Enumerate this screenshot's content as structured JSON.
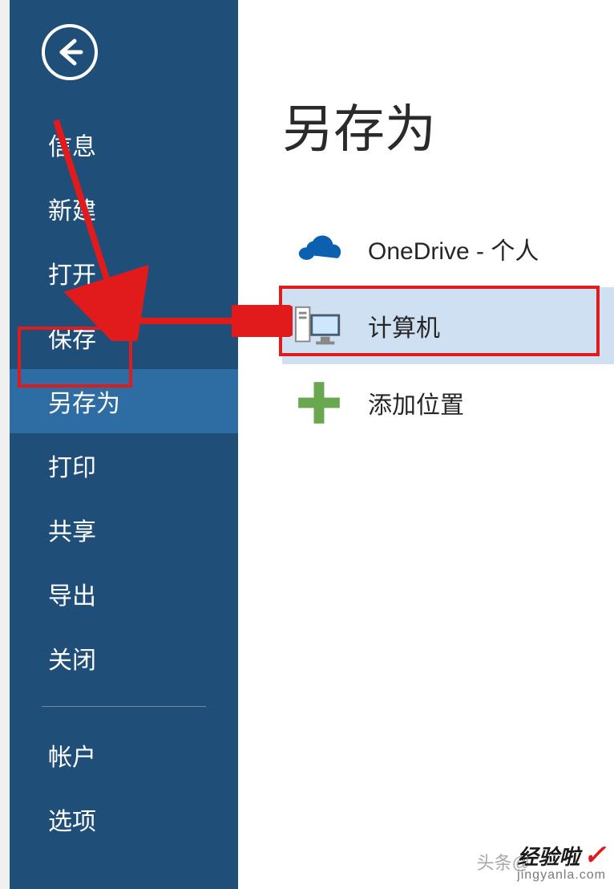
{
  "sidebar": {
    "items": [
      {
        "label": "信息"
      },
      {
        "label": "新建"
      },
      {
        "label": "打开"
      },
      {
        "label": "保存"
      },
      {
        "label": "另存为"
      },
      {
        "label": "打印"
      },
      {
        "label": "共享"
      },
      {
        "label": "导出"
      },
      {
        "label": "关闭"
      },
      {
        "label": "帐户"
      },
      {
        "label": "选项"
      }
    ],
    "selected_index": 4
  },
  "content": {
    "title": "另存为",
    "locations": [
      {
        "icon": "onedrive",
        "label": "OneDrive - 个人"
      },
      {
        "icon": "computer",
        "label": "计算机"
      },
      {
        "icon": "add",
        "label": "添加位置"
      }
    ],
    "selected_index": 1
  },
  "watermark": {
    "brand": "经验啦",
    "url": "jingyanla.com",
    "toushao": "头条@"
  },
  "colors": {
    "sidebar_bg": "#1f4e79",
    "sidebar_selected": "#2e6ca4",
    "content_selected": "#cfe0f2",
    "highlight": "#e11b1b",
    "onedrive": "#0b60b0",
    "add_plus": "#6aa84f"
  }
}
